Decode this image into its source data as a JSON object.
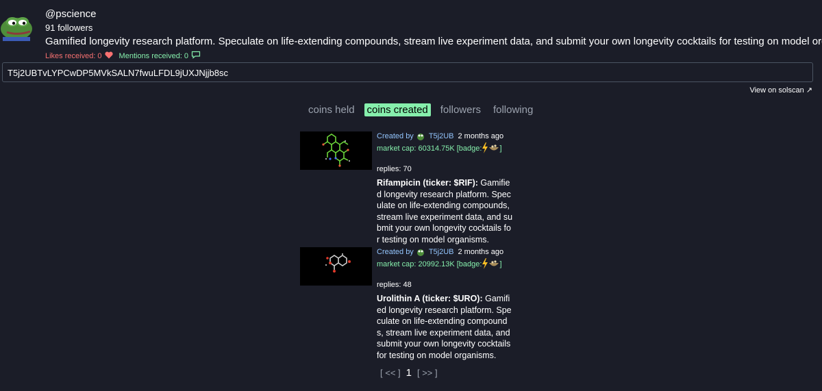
{
  "profile": {
    "avatar_icon": "pepe-frog-avatar",
    "username": "@pscience",
    "followers": "91 followers",
    "bio": "Gamified longevity research platform. Speculate on life-extending compounds, stream live experiment data, and submit your own longevity cocktails for testing on model organisms.",
    "likes_label": "Likes received: 0",
    "mentions_label": "Mentions received: 0"
  },
  "address": "T5j2UBTvLYPCwDP5MVkSALN7fwuLFDL9jUXJNjjb8sc",
  "solscan_label": "View on solscan ↗",
  "tabs": [
    "coins held",
    "coins created",
    "followers",
    "following"
  ],
  "active_tab": "coins created",
  "coins": [
    {
      "created_by_label": "Created by",
      "creator": "T5j2UB",
      "time": "2 months ago",
      "market_cap": "market cap: 60314.75K",
      "badge_label": "[badge:",
      "badge_close": "]",
      "replies": "replies: 70",
      "name": "Rifampicin (ticker: $RIF):",
      "description": "Gamified longevity research platform. Speculate on life-extending compounds, stream live experiment data, and submit your own longevity cocktails for testing on model organisms."
    },
    {
      "created_by_label": "Created by",
      "creator": "T5j2UB",
      "time": "2 months ago",
      "market_cap": "market cap: 20992.13K",
      "badge_label": "[badge:",
      "badge_close": "]",
      "replies": "replies: 48",
      "name": "Urolithin A (ticker: $URO):",
      "description": "Gamified longevity research platform. Speculate on life-extending compounds, stream live experiment data, and submit your own longevity cocktails for testing on model organisms."
    }
  ],
  "pagination": {
    "prev": "[ << ]",
    "current": "1",
    "next": "[ >> ]"
  },
  "colors": {
    "background": "#1b1d28",
    "accent_green": "#86efac",
    "likes_red": "#f87171",
    "link_blue": "#93c5fd"
  }
}
